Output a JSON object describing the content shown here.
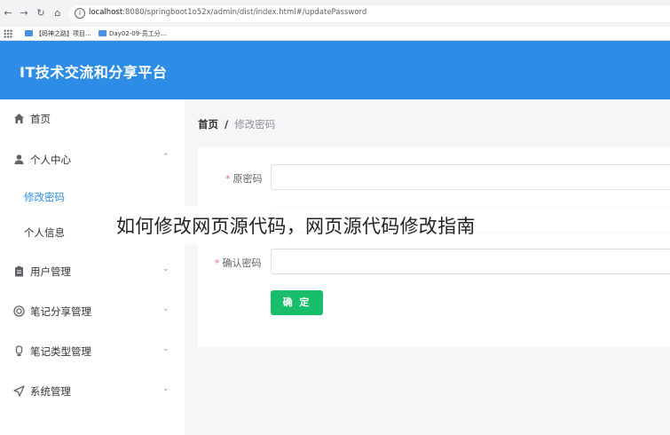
{
  "browser": {
    "url_host": "localhost",
    "url_path": ":8080/springboot1o52x/admin/dist/index.html#/updatePassword",
    "bookmarks": [
      {
        "label": "【码神之路】项目..."
      },
      {
        "label": "Day02-09-员工分..."
      }
    ]
  },
  "app": {
    "title": "IT技术交流和分享平台"
  },
  "sidebar": {
    "items": [
      {
        "label": "首页",
        "icon": "home-icon"
      },
      {
        "label": "个人中心",
        "icon": "user-icon",
        "expanded": true
      },
      {
        "label": "修改密码",
        "active": true
      },
      {
        "label": "个人信息"
      },
      {
        "label": "用户管理",
        "icon": "clipboard-icon"
      },
      {
        "label": "笔记分享管理",
        "icon": "share-circle-icon"
      },
      {
        "label": "笔记类型管理",
        "icon": "bulb-icon"
      },
      {
        "label": "系统管理",
        "icon": "send-icon"
      }
    ]
  },
  "breadcrumb": {
    "home": "首页",
    "separator": "/",
    "current": "修改密码"
  },
  "form": {
    "old_password_label": "原密码",
    "confirm_password_label": "确认密码",
    "required_mark": "*",
    "confirm_button": "确 定"
  },
  "overlay": {
    "caption": "如何修改网页源代码，网页源代码修改指南"
  },
  "colors": {
    "header": "#2d8de6",
    "active": "#2d8de6",
    "button": "#19be6b",
    "required": "#f56c6c"
  }
}
